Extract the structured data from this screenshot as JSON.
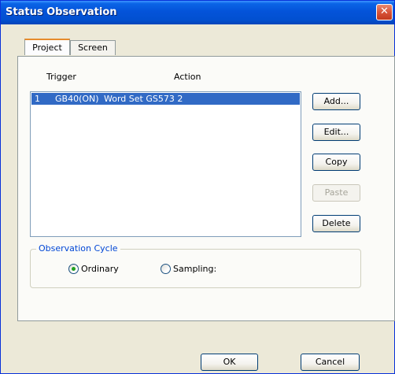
{
  "window": {
    "title": "Status Observation",
    "close_icon": "close-x-icon"
  },
  "tabs": [
    {
      "label": "Project",
      "active": true
    },
    {
      "label": "Screen",
      "active": false
    }
  ],
  "list": {
    "columns": [
      "Trigger",
      "Action"
    ],
    "rows": [
      {
        "index": "1",
        "trigger": "GB40(ON)",
        "action": "Word Set GS573  2",
        "selected": true
      }
    ]
  },
  "buttons": {
    "add": "Add...",
    "edit": "Edit...",
    "copy": "Copy",
    "paste": "Paste",
    "delete": "Delete",
    "ok": "OK",
    "cancel": "Cancel"
  },
  "observation_cycle": {
    "title": "Observation Cycle",
    "options": [
      {
        "label": "Ordinary",
        "selected": true
      },
      {
        "label": "Sampling:",
        "selected": false
      }
    ]
  },
  "colors": {
    "title_bar": "#0453d9",
    "selection": "#316ac5",
    "group_title": "#0046d5",
    "active_tab_accent": "#e68b2c"
  }
}
